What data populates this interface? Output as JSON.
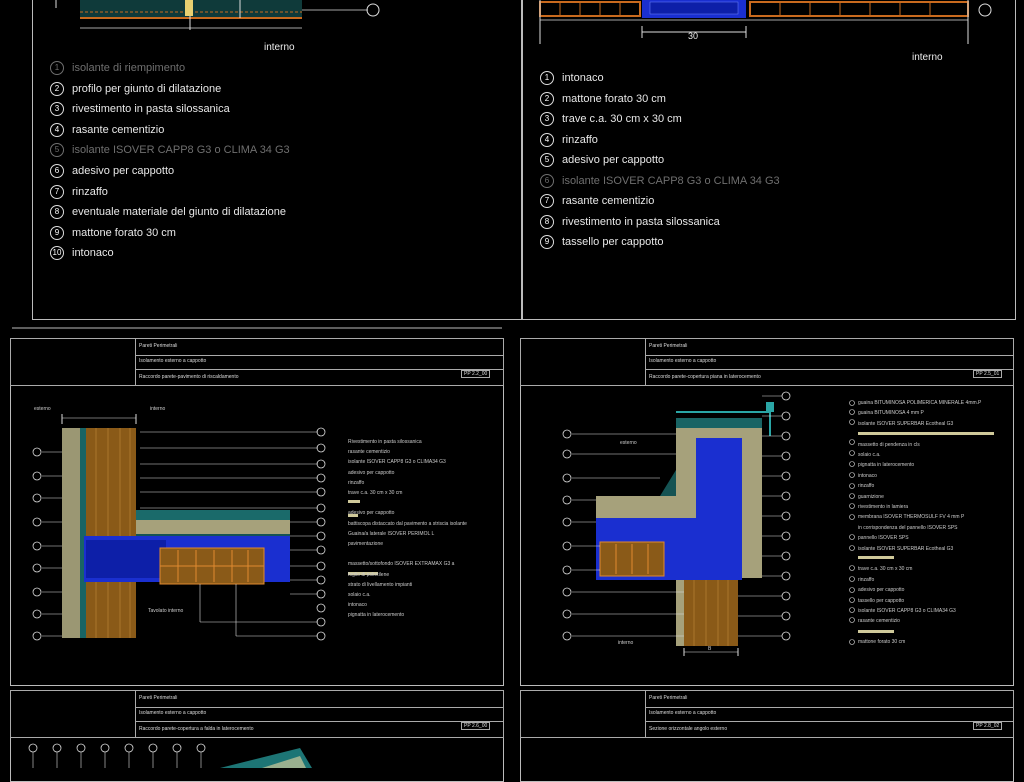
{
  "panel_top_left": {
    "interior_label": "interno",
    "legend": [
      {
        "n": "1",
        "text": "isolante di riempimento",
        "dim": true
      },
      {
        "n": "2",
        "text": "profilo per giunto di dilatazione",
        "dim": false
      },
      {
        "n": "3",
        "text": "rivestimento in pasta silossanica",
        "dim": false
      },
      {
        "n": "4",
        "text": "rasante cementizio",
        "dim": false
      },
      {
        "n": "5",
        "text": "isolante ISOVER CAPP8 G3 o CLIMA 34 G3",
        "dim": true
      },
      {
        "n": "6",
        "text": "adesivo per cappotto",
        "dim": false
      },
      {
        "n": "7",
        "text": "rinzaffo",
        "dim": false
      },
      {
        "n": "8",
        "text": "eventuale materiale del giunto di dilatazione",
        "dim": false
      },
      {
        "n": "9",
        "text": "mattone forato 30 cm",
        "dim": false
      },
      {
        "n": "10",
        "text": "intonaco",
        "dim": false
      }
    ]
  },
  "panel_top_right": {
    "interior_label": "interno",
    "dimension": "30",
    "legend": [
      {
        "n": "1",
        "text": "intonaco",
        "dim": false
      },
      {
        "n": "2",
        "text": "mattone forato 30 cm",
        "dim": false
      },
      {
        "n": "3",
        "text": "trave c.a. 30 cm x 30 cm",
        "dim": false
      },
      {
        "n": "4",
        "text": "rinzaffo",
        "dim": false
      },
      {
        "n": "5",
        "text": "adesivo per cappotto",
        "dim": false
      },
      {
        "n": "6",
        "text": "isolante ISOVER CAPP8 G3 o CLIMA 34 G3",
        "dim": true
      },
      {
        "n": "7",
        "text": "rasante cementizio",
        "dim": false
      },
      {
        "n": "8",
        "text": "rivestimento in pasta silossanica",
        "dim": false
      },
      {
        "n": "9",
        "text": "tassello per cappotto",
        "dim": false
      }
    ]
  },
  "sheet_mid_left": {
    "title": "Pareti Perimetrali",
    "subtitle": "Isolamento esterno a cappotto",
    "description": "Raccordo parete-pavimento di riscaldamento",
    "code": "PP 2.2_00",
    "exterior_label": "esterno",
    "interior_label": "interno",
    "bottom_label": "Tavolato interno",
    "legend": [
      "Rivestimento in pasta silossanica",
      "rasante cementizio",
      "isolante ISOVER CAPP8 G3 o CLIMA34 G3",
      "adesivo per cappotto",
      "rinzaffo",
      "trave c.a. 30 cm x 30 cm",
      "",
      "adesivo per cappotto",
      "battiscopa distaccato dal pavimento a striscia isolante",
      "Guaina/a laterale ISOVER PERIMOL L",
      "pavimentazione",
      "",
      "massetto/sottofondo ISOVER EXTRAMAX G3 a",
      "foglio di polietilene",
      "strato di livellamento impianti",
      "solaio c.a.",
      "intonaco",
      "pignatta in laterocemento"
    ]
  },
  "sheet_mid_right": {
    "title": "Pareti Perimetrali",
    "subtitle": "Isolamento esterno a cappotto",
    "description": "Raccordo parete-copertura piana in laterocemento",
    "code": "PP 2.5_01",
    "exterior_label": "esterno",
    "interior_label": "interno",
    "dimension": "B",
    "legend": [
      "guaina BITUMINOSA POLIMERICA MINERALE 4mm.P",
      "guaina BITUMINOSA 4 mm P",
      "isolante ISOVER SUPERBAR Ecotheal G3",
      "",
      "massetto di pendenza in cls",
      "solaio c.a.",
      "pignatta in laterocemento",
      "intonaco",
      "rinzaffo",
      "guarnizione",
      "rivestimento in lamiera",
      "membrana ISOVER THERMOSULF FV 4 mm P",
      "in corrispondenza del pannello ISOVER SPS",
      "pannello ISOVER SPS",
      "isolante ISOVER SUPERBAR Ecotheal G3",
      "",
      "trave c.a. 30 cm x 30 cm",
      "rinzaffo",
      "adesivo per cappotto",
      "tassello per cappotto",
      "isolante ISOVER CAPP8 G3 o CLIMA34 G3",
      "rasante cementizio",
      "",
      "mattone forato 30 cm"
    ]
  },
  "sheet_bottom_left": {
    "title": "Pareti Perimetrali",
    "subtitle": "Isolamento esterno a cappotto",
    "description": "Raccordo parete-copertura a falda in laterocemento",
    "code": "PP 2.6_00"
  },
  "sheet_bottom_right": {
    "title": "Pareti Perimetrali",
    "subtitle": "Isolamento esterno a cappotto",
    "description": "Sezione orizzontale angolo esterno",
    "code": "PP 2.8_02"
  },
  "colors": {
    "background": "#000000",
    "insulation": "#1a2fd0",
    "brick": "#c96a1e",
    "wood": "#8a5a18",
    "concrete": "#cfc99a",
    "teal": "#2aa6a6",
    "watermark": "#8a8a8a"
  }
}
